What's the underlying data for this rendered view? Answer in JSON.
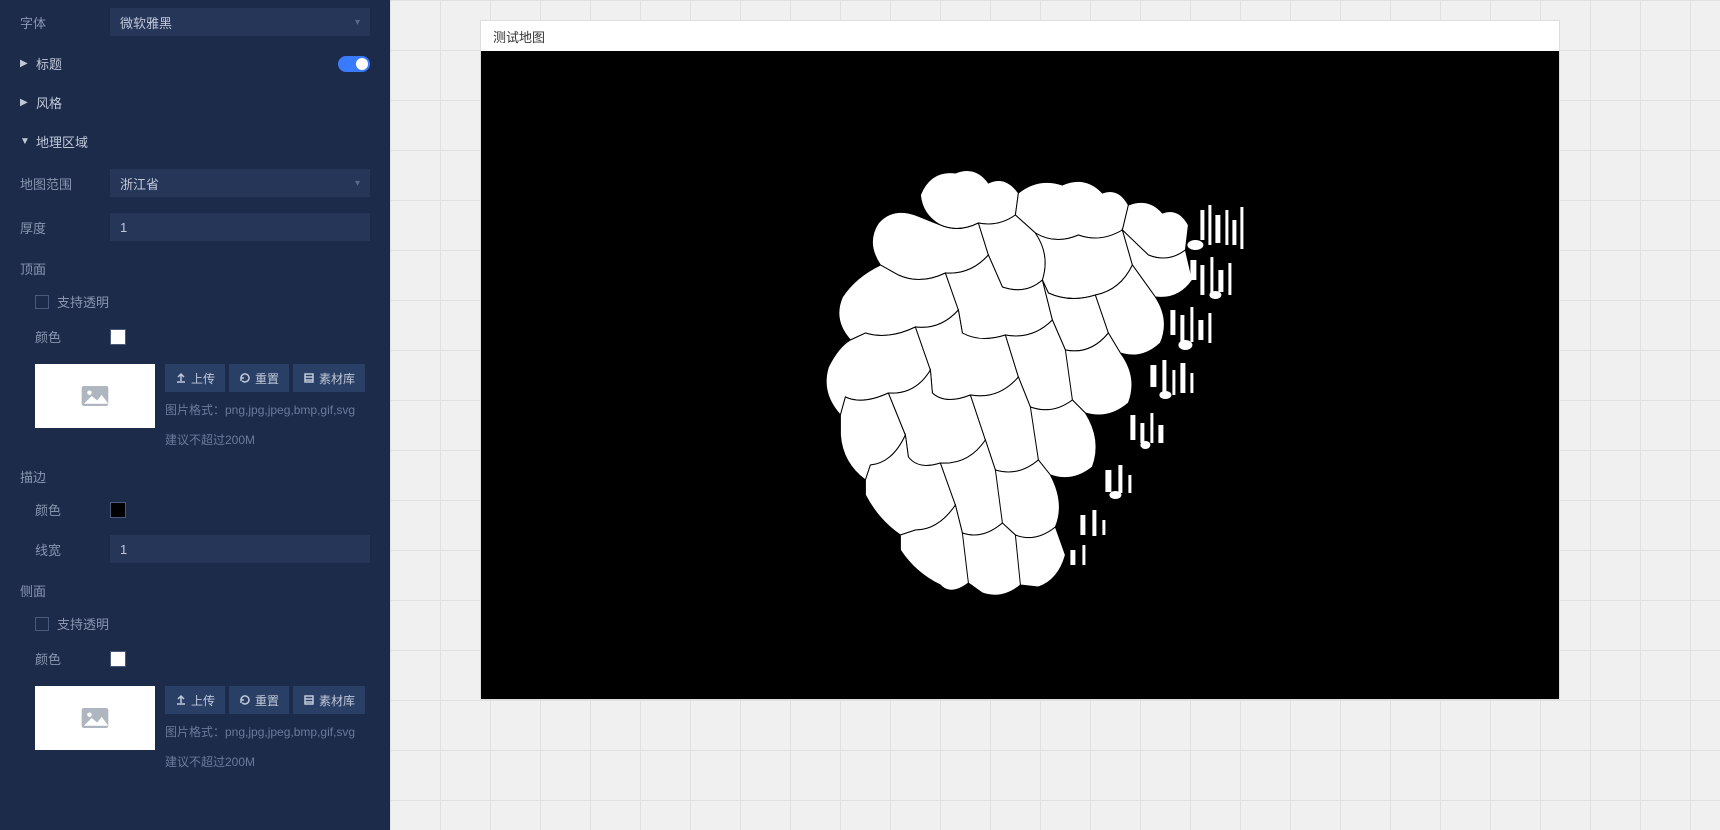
{
  "sidebar": {
    "font_label": "字体",
    "font_value": "微软雅黑",
    "title_section": "标题",
    "style_section": "风格",
    "geo_section": "地理区域",
    "map_range_label": "地图范围",
    "map_range_value": "浙江省",
    "thickness_label": "厚度",
    "thickness_value": "1",
    "top_face": "顶面",
    "transparent_label": "支持透明",
    "color_label": "颜色",
    "upload_btn": "上传",
    "reset_btn": "重置",
    "library_btn": "素材库",
    "hint1": "图片格式：png,jpg,jpeg,bmp,gif,svg",
    "hint2": "建议不超过200M",
    "stroke_section": "描边",
    "line_width_label": "线宽",
    "line_width_value": "1",
    "side_face": "侧面"
  },
  "canvas": {
    "map_title": "测试地图"
  },
  "colors": {
    "top_color": "#ffffff",
    "stroke_color": "#000000",
    "side_color": "#ffffff"
  }
}
